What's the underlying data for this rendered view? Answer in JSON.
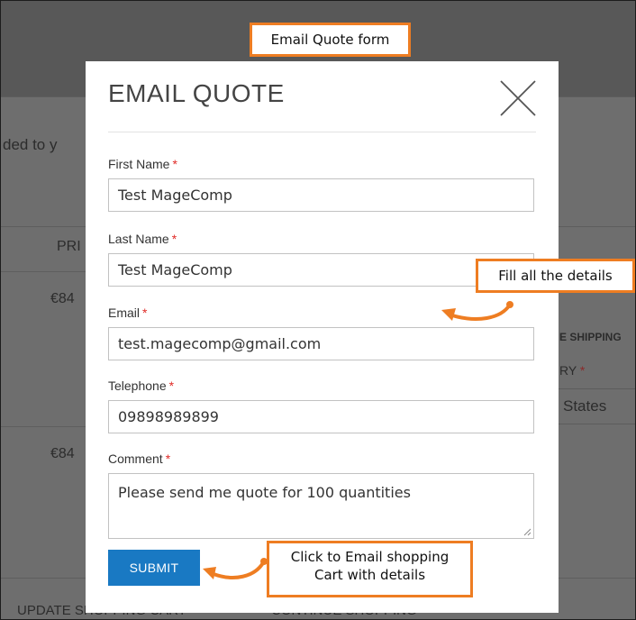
{
  "background": {
    "fragment_added": "ded to y",
    "col_price": "PRI",
    "price_1": "€84",
    "price_2": "€84",
    "shipping_fragment": "E SHIPPING",
    "country_fragment": "RY",
    "states_fragment": "States",
    "update_cart": "UPDATE SHOPPING CART",
    "continue_shopping": "CONTINUE SHOPPING"
  },
  "callouts": {
    "form_title": "Email Quote form",
    "fill_details": "Fill all the details",
    "submit_hint_line1": "Click to Email shopping",
    "submit_hint_line2": "Cart with details"
  },
  "modal": {
    "title": "EMAIL QUOTE",
    "required_mark": "*",
    "fields": [
      {
        "label": "First Name",
        "value": "Test MageComp"
      },
      {
        "label": "Last Name",
        "value": "Test MageComp"
      },
      {
        "label": "Email",
        "value": "test.magecomp@gmail.com"
      },
      {
        "label": "Telephone",
        "value": "09898989899"
      },
      {
        "label": "Comment",
        "value": "Please send me quote for 100 quantities"
      }
    ],
    "submit_label": "SUBMIT"
  },
  "colors": {
    "accent_orange": "#ee7d22",
    "submit_blue": "#1979c3",
    "required_red": "#e02b27"
  }
}
